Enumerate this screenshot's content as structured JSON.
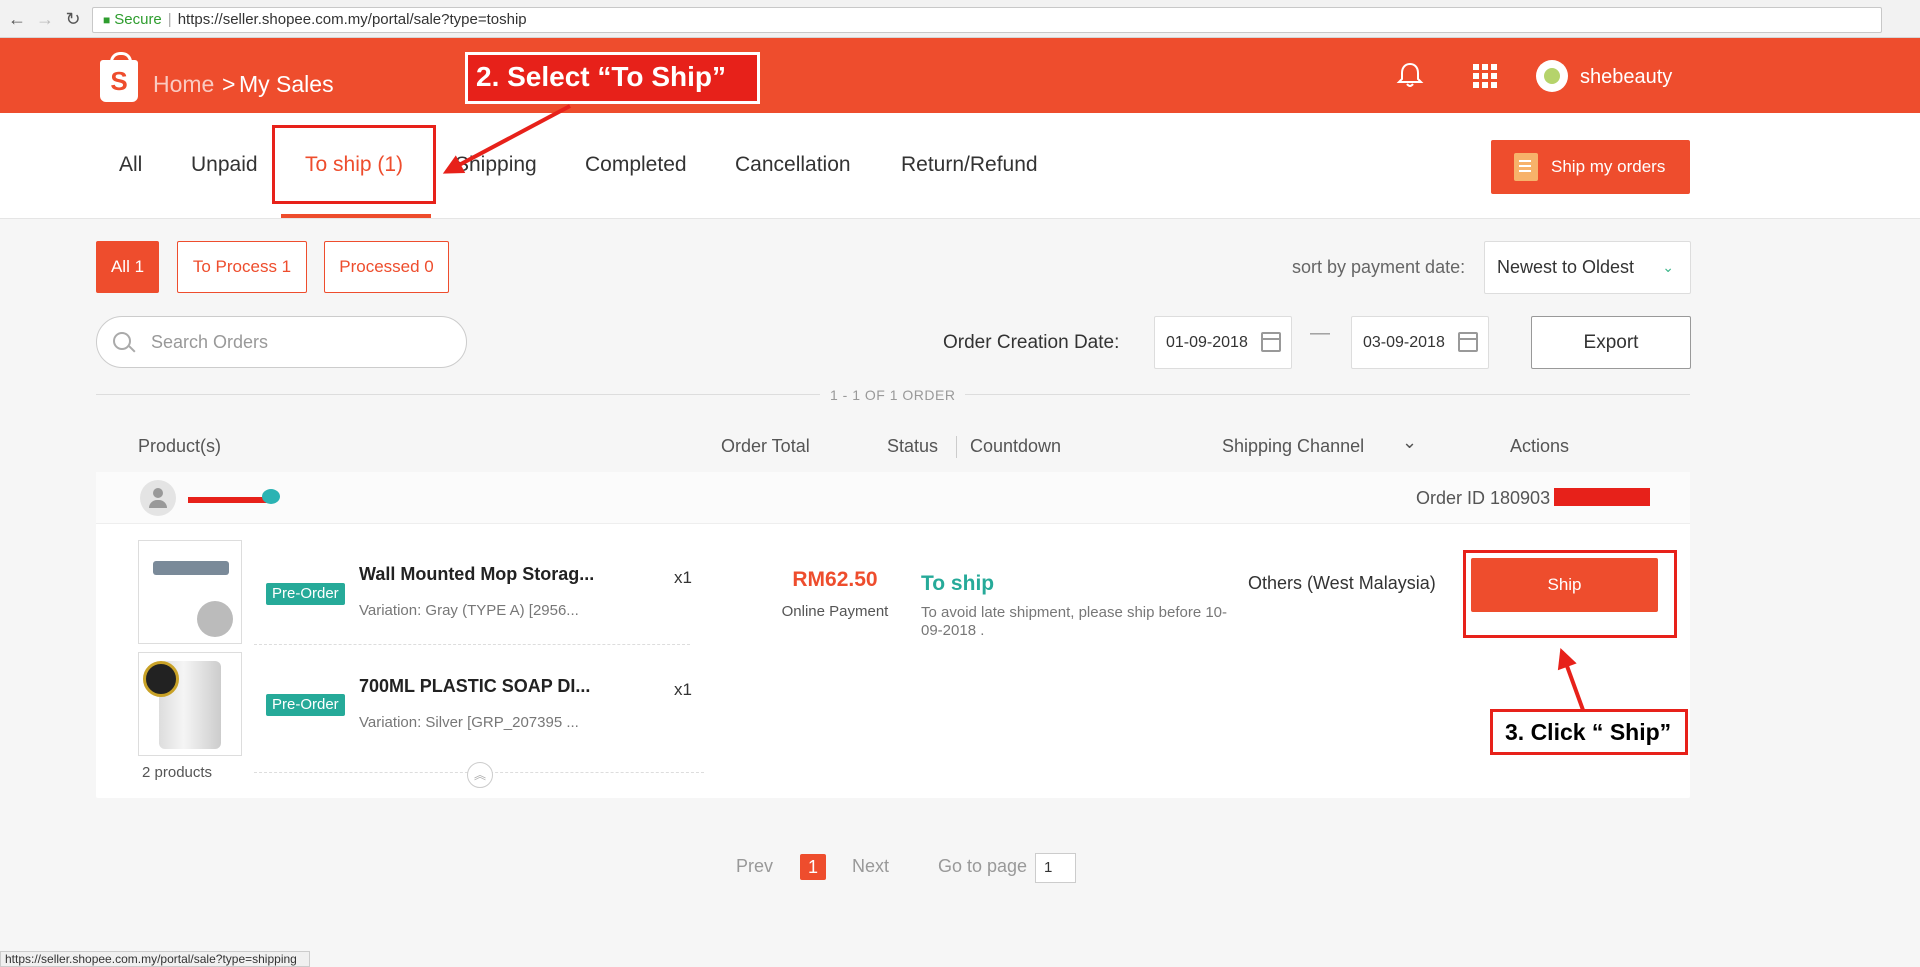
{
  "browser": {
    "secure_label": "Secure",
    "url": "https://seller.shopee.com.my/portal/sale?type=toship",
    "status_url": "https://seller.shopee.com.my/portal/sale?type=shipping"
  },
  "header": {
    "logo_letter": "S",
    "breadcrumb_home": "Home",
    "breadcrumb_sep": ">",
    "breadcrumb_current": "My Sales",
    "username": "shebeauty"
  },
  "annotations": {
    "step2": "2.  Select “To Ship”",
    "step3": "3. Click “ Ship”"
  },
  "tabs": [
    {
      "label": "All"
    },
    {
      "label": "Unpaid"
    },
    {
      "label": "To ship (1)"
    },
    {
      "label": "Shipping"
    },
    {
      "label": "Completed"
    },
    {
      "label": "Cancellation"
    },
    {
      "label": "Return/Refund"
    }
  ],
  "ship_my_orders_label": "Ship my orders",
  "filters": [
    {
      "label": "All 1"
    },
    {
      "label": "To Process 1"
    },
    {
      "label": "Processed 0"
    }
  ],
  "sort": {
    "label": "sort by payment date:",
    "value": "Newest to Oldest"
  },
  "search": {
    "placeholder": "Search Orders"
  },
  "date_filter": {
    "label": "Order Creation Date:",
    "from": "01-09-2018",
    "separator": "—",
    "to": "03-09-2018"
  },
  "export_label": "Export",
  "count_label": "1 - 1 OF 1 ORDER",
  "table_headers": {
    "products": "Product(s)",
    "order_total": "Order Total",
    "status": "Status",
    "countdown": "Countdown",
    "shipping_channel": "Shipping Channel",
    "actions": "Actions"
  },
  "order": {
    "order_id_label": "Order ID 180903",
    "products": [
      {
        "badge": "Pre-Order",
        "name": "Wall Mounted Mop Storag...",
        "variation": "Variation: Gray (TYPE A) [2956...",
        "qty": "x1"
      },
      {
        "badge": "Pre-Order",
        "name": "700ML PLASTIC SOAP DI...",
        "variation": "Variation: Silver [GRP_207395 ...",
        "qty": "x1"
      }
    ],
    "product_count": "2 products",
    "total": "RM62.50",
    "payment": "Online Payment",
    "status": "To ship",
    "status_note": "To avoid late shipment, please ship before 10-09-2018 .",
    "channel": "Others (West Malaysia)",
    "action_label": "Ship"
  },
  "pagination": {
    "prev": "Prev",
    "current": "1",
    "next": "Next",
    "goto_label": "Go to page",
    "goto_value": "1"
  },
  "colors": {
    "brand": "#ee4d2d",
    "status": "#26aa99",
    "annotation": "#e7211a"
  }
}
